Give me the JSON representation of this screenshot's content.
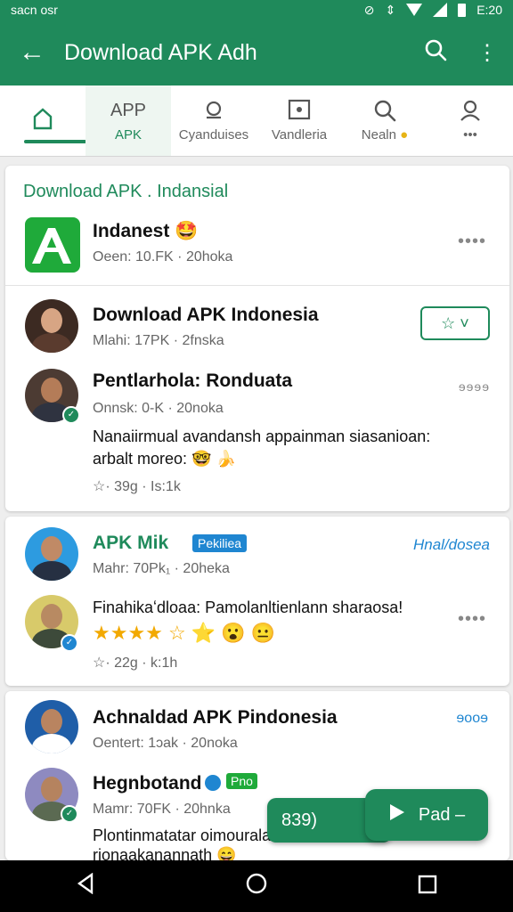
{
  "status": {
    "time": "sacn osr",
    "right_time": "E:20",
    "icons": [
      "alarm-icon",
      "vibrate-icon",
      "wifi-icon",
      "signal-icon",
      "battery-icon"
    ]
  },
  "appbar": {
    "title": "Download APK Adh"
  },
  "tabs": [
    {
      "label": "",
      "icon": "home-icon"
    },
    {
      "label": "APK",
      "top": "APP",
      "icon": "apps-icon"
    },
    {
      "label": "Cyanduises",
      "icon": "bell-icon"
    },
    {
      "label": "Vandleria",
      "icon": "gallery-icon"
    },
    {
      "label": "Nealn",
      "icon": "search-icon"
    },
    {
      "label": "•••",
      "icon": "person-icon"
    }
  ],
  "card1": {
    "header": "Download APK . Indansial",
    "app": {
      "name": "Indanest",
      "emoji": "🤩",
      "meta": "Oeen: 10.FK · 20hoka",
      "more": "••••"
    },
    "post": {
      "name": "Download APK Indonesia",
      "meta": "Mlahi: 17PK · 2fnska",
      "follow": "☆ ˅"
    },
    "comment": {
      "name": "Pentlarhola: Ronduata",
      "meta": "Onnsk: 0-K · 20noka",
      "more": "ɘɘɘɘ",
      "line1": "Nanaiirmual avandansh appainman siasanioan:",
      "line2": "arbalt moreo: 🤓 🍌",
      "stats": "☆· 39g · Is:1k"
    }
  },
  "card2": {
    "author": {
      "name": "APK Mik",
      "badge": "Pekiliea",
      "right": "Hnal/dosea",
      "meta": "Mahr: 70Pk₁ · 20heka"
    },
    "comment": {
      "line1": "Finahikaʻdloaa: Pamolanltienlann sharaosa!",
      "stars": "★★★★",
      "extra": "☆ ⭐ 😮 😐",
      "more": "••••",
      "stats": "☆· 22g · k:1h"
    }
  },
  "card3": {
    "author": {
      "name": "Achnaldad APK Pindonesia",
      "meta": "Oentert: 1ɔak · 20noka",
      "more": "ɘooɘ"
    },
    "comment": {
      "name": "Hegnbotand",
      "badge2": "Pno",
      "meta": "Mamr: 70FK · 20hnka",
      "line1": "Plontinmatatar oimouralar",
      "line2": "rionaakanannath 😄"
    }
  },
  "fab": {
    "left_label": "839)",
    "right_label": "Pad –"
  },
  "nav": [
    "back-icon",
    "home-circle-icon",
    "recents-icon"
  ]
}
